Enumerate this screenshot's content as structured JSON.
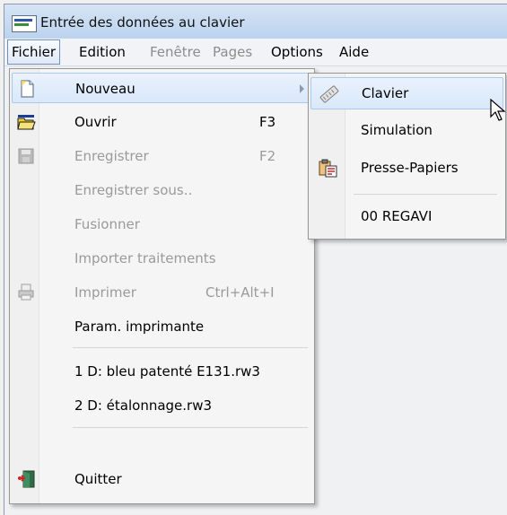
{
  "window": {
    "title": "Entrée des données au clavier",
    "app_icon": "keyboard-app-icon"
  },
  "menubar": {
    "items": [
      {
        "label": "Fichier",
        "state": "open"
      },
      {
        "label": "Edition",
        "state": "enabled"
      },
      {
        "label": "Fenêtre",
        "state": "disabled"
      },
      {
        "label": "Pages",
        "state": "disabled"
      },
      {
        "label": "Options",
        "state": "enabled"
      },
      {
        "label": "Aide",
        "state": "enabled"
      }
    ]
  },
  "file_menu": {
    "items": [
      {
        "label": "Nouveau",
        "icon": "new-document-icon",
        "has_submenu": true,
        "highlighted": true
      },
      {
        "label": "Ouvrir",
        "shortcut": "F3",
        "icon": "open-folder-icon"
      },
      {
        "label": "Enregistrer",
        "shortcut": "F2",
        "icon": "save-icon",
        "disabled": true
      },
      {
        "label": "Enregistrer sous..",
        "disabled": true
      },
      {
        "label": "Fusionner",
        "disabled": true
      },
      {
        "label": "Importer traitements",
        "disabled": true
      },
      {
        "label": "Imprimer",
        "shortcut": "Ctrl+Alt+I",
        "icon": "printer-icon",
        "disabled": true
      },
      {
        "label": "Param. imprimante"
      },
      {
        "label": "1 D: bleu patenté E131.rw3"
      },
      {
        "label": "2 D: étalonnage.rw3"
      },
      {
        "label": "Quitter",
        "icon": "exit-door-icon"
      }
    ]
  },
  "submenu_nouveau": {
    "items": [
      {
        "label": "Clavier",
        "icon": "keyboard-icon",
        "highlighted": true
      },
      {
        "label": "Simulation"
      },
      {
        "label": "Presse-Papiers",
        "icon": "clipboard-icon"
      },
      {
        "label": "00 REGAVI"
      }
    ]
  },
  "colors": {
    "highlight": "#d9e8fa",
    "highlight_border": "#a8c9f0",
    "disabled_text": "#9a9a9a"
  }
}
